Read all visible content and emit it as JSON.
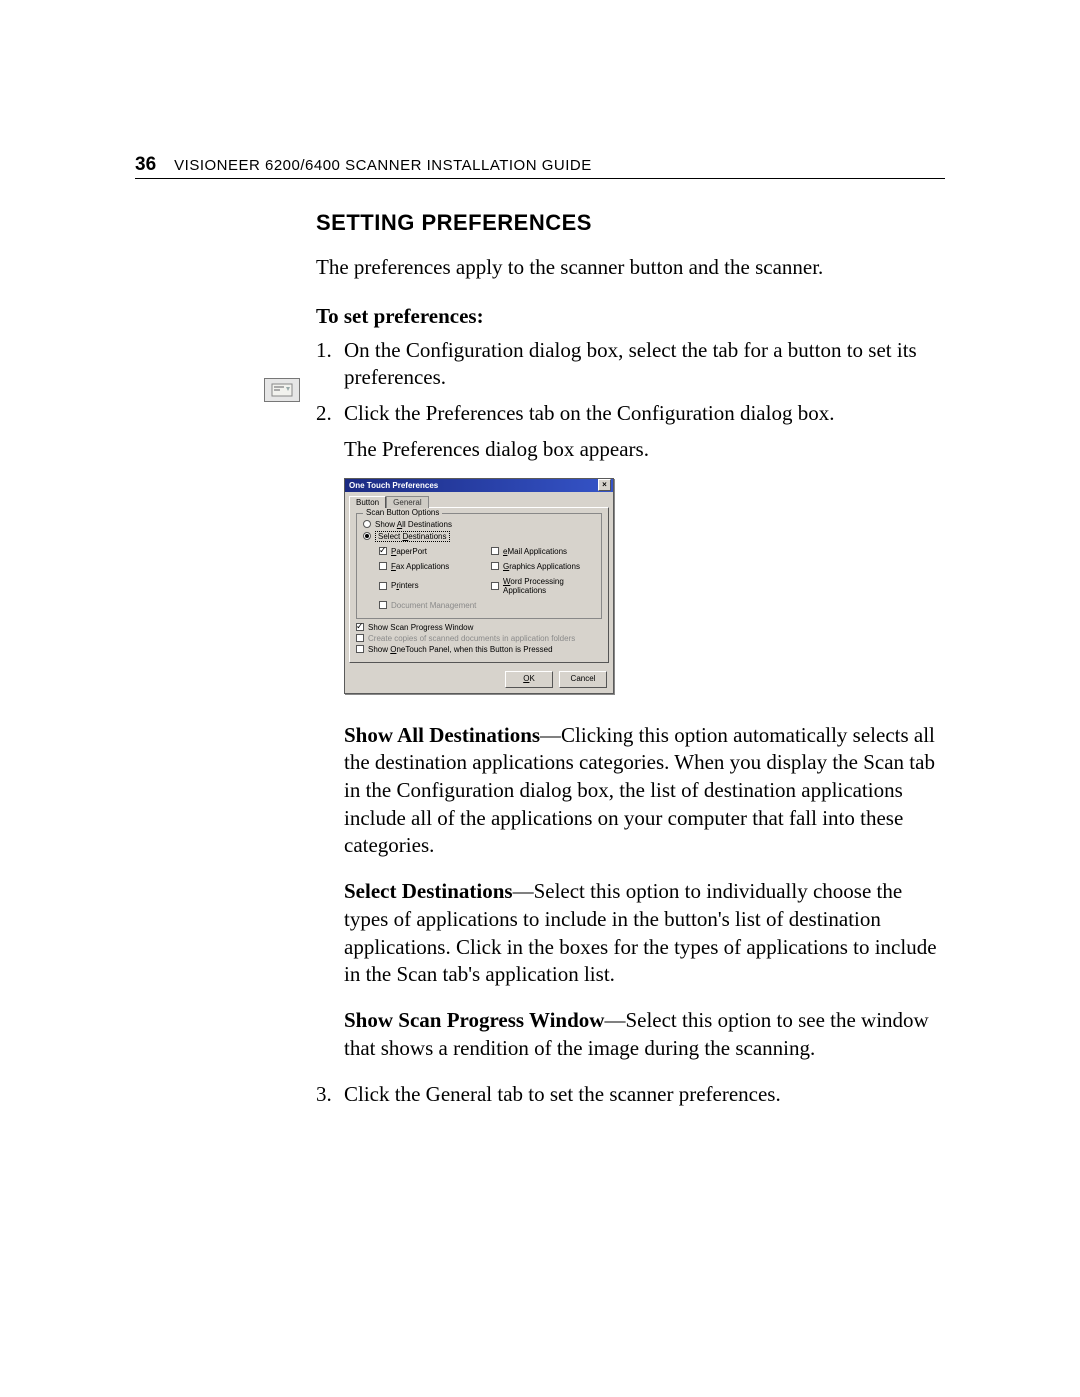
{
  "header": {
    "page_number": "36",
    "running_head": "VISIONEER 6200/6400 SCANNER INSTALLATION GUIDE"
  },
  "section_title": "SETTING PREFERENCES",
  "intro": "The preferences apply to the scanner button and the scanner.",
  "subhead": "To set preferences:",
  "steps": {
    "s1_num": "1.",
    "s1_text": "On the Configuration dialog box, select the tab for a button to set its preferences.",
    "s2_num": "2.",
    "s2_text": "Click the Preferences tab on the Configuration dialog box.",
    "s2_follow": "The Preferences dialog box appears.",
    "s3_num": "3.",
    "s3_text": "Click the General tab to set the scanner preferences."
  },
  "margin_icon_name": "preferences-tab-icon",
  "dialog": {
    "title": "One Touch Preferences",
    "close_label": "×",
    "tabs": {
      "button": "Button",
      "general": "General"
    },
    "group_label": "Scan Button Options",
    "show_all_u": "A",
    "show_all_rest": "ll Destinations",
    "show_all_pre": "Show ",
    "select_u": "D",
    "select_rest": "estinations",
    "select_pre": "Select ",
    "checks": {
      "paperport_u": "P",
      "paperport_rest": "aperPort",
      "email_u": "e",
      "email_rest": "Mail Applications",
      "fax_u": "F",
      "fax_rest": "ax Applications",
      "graphics_u": "G",
      "graphics_rest": "raphics Applications",
      "printers_u": "r",
      "printers_pre": "P",
      "printers_rest": "inters",
      "word_u": "W",
      "word_rest": "ord Processing Applications",
      "document_pre": "Document ",
      "document_rest": "Management"
    },
    "show_progress": "Show Scan Progress Window",
    "paper_question_disabled": "Create copies of scanned documents in application folders",
    "show_panel_pre": "Show ",
    "show_panel_u": "O",
    "show_panel_rest": "neTouch Panel, when this Button is Pressed",
    "ok_u": "O",
    "ok_rest": "K",
    "cancel_label": "Cancel"
  },
  "definitions": {
    "d1_term": "Show All Destinations",
    "d1_body": "—Clicking this option automatically selects all the destination applications categories. When you display the Scan tab in the Configuration dialog box, the list of destination applications include all of the applications on your computer that fall into these categories.",
    "d2_term": "Select Destinations",
    "d2_body": "—Select this option to individually choose the types of applications to include in the button's list of destination applications. Click in the boxes for the types of applications to include in the Scan tab's application list.",
    "d3_term": "Show Scan Progress Window",
    "d3_body": "—Select this option to see the window that shows a rendition of the image during the scanning."
  }
}
